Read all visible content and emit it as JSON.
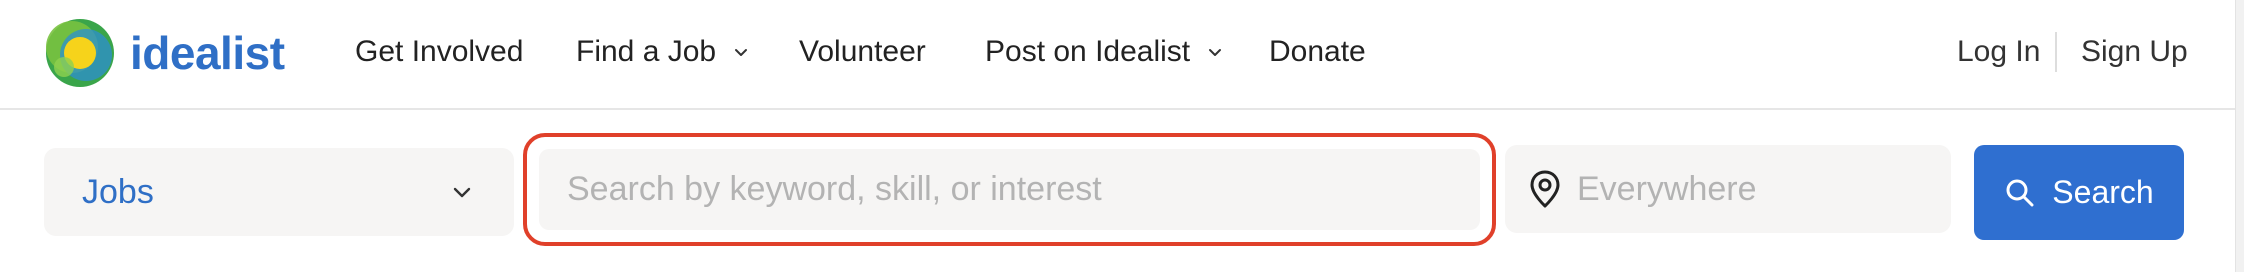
{
  "brand": {
    "name": "idealist",
    "accent_color": "#2f6fc6"
  },
  "nav": {
    "items": [
      {
        "label": "Get Involved",
        "has_dropdown": false
      },
      {
        "label": "Find a Job",
        "has_dropdown": true
      },
      {
        "label": "Volunteer",
        "has_dropdown": false
      },
      {
        "label": "Post on Idealist",
        "has_dropdown": true
      },
      {
        "label": "Donate",
        "has_dropdown": false
      }
    ],
    "log_in": "Log In",
    "sign_up": "Sign Up"
  },
  "search": {
    "type_select": {
      "selected": "Jobs",
      "icon": "chevron-down-icon"
    },
    "keyword": {
      "value": "",
      "placeholder": "Search by keyword, skill, or interest",
      "highlight_color": "#e0402a"
    },
    "location": {
      "value": "",
      "placeholder": "Everywhere",
      "icon": "location-pin-icon"
    },
    "button": {
      "label": "Search",
      "icon": "search-icon",
      "color": "#2f6fd0"
    }
  }
}
